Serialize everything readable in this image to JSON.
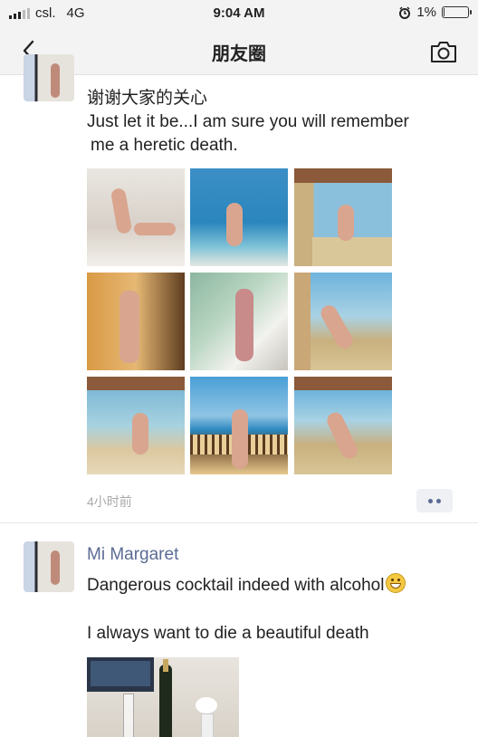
{
  "status_bar": {
    "carrier": "csl.",
    "network": "4G",
    "time": "9:04 AM",
    "battery_percent": "1%",
    "battery_level": 0.01
  },
  "nav": {
    "title": "朋友圈",
    "back_icon": "chevron-left-icon",
    "camera_icon": "camera-icon"
  },
  "post1": {
    "line1": "谢谢大家的关心",
    "line2": "Just let it be...I am sure you will remember",
    "line3": "me a heretic death.",
    "time_ago": "4小时前",
    "more_icon": "more-dots-icon"
  },
  "post2": {
    "author": "Mi Margaret",
    "line1": "Dangerous cocktail indeed with alcohol",
    "line2": "I always want to die a beautiful death",
    "emoji": "grinning-face-emoji"
  }
}
